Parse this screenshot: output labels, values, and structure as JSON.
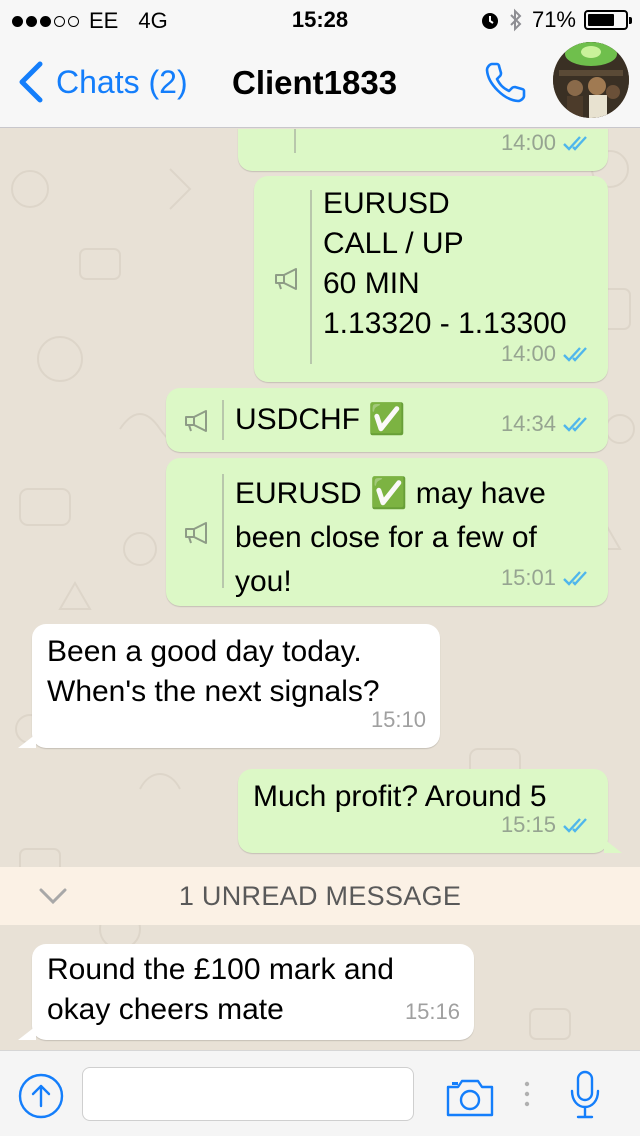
{
  "status_bar": {
    "carrier": "EE",
    "network": "4G",
    "time": "15:28",
    "battery": "71%",
    "battery_level": 0.71,
    "signal_filled": 3,
    "signal_total": 5
  },
  "nav": {
    "back_label": "Chats (2)",
    "title": "Client1833"
  },
  "messages": [
    {
      "dir": "out",
      "text": "",
      "time": "14:00",
      "forwarded": true,
      "status": "read"
    },
    {
      "dir": "out",
      "lines": [
        "EURUSD",
        "CALL / UP",
        "60 MIN",
        "1.13320 - 1.13300"
      ],
      "time": "14:00",
      "forwarded": true,
      "status": "read"
    },
    {
      "dir": "out",
      "text": "USDCHF ✅",
      "time": "14:34",
      "forwarded": true,
      "status": "read"
    },
    {
      "dir": "out",
      "lines": [
        "EURUSD ✅ may have",
        "been close for a few of",
        "you!"
      ],
      "time": "15:01",
      "forwarded": true,
      "status": "read"
    },
    {
      "dir": "in",
      "lines": [
        "Been a good day today.",
        "When's the next signals?"
      ],
      "time": "15:10"
    },
    {
      "dir": "out",
      "text": "Much profit? Around 5",
      "time": "15:15",
      "status": "read"
    },
    {
      "dir": "in",
      "lines": [
        "Round the £100 mark and",
        "okay cheers mate"
      ],
      "time": "15:16"
    }
  ],
  "unread": {
    "label": "1 UNREAD MESSAGE"
  },
  "input": {
    "value": "",
    "placeholder": ""
  },
  "icons": {
    "back": "chevron-left-icon",
    "call": "phone-icon",
    "forwarded": "megaphone-icon",
    "read": "double-check-icon",
    "unread_toggle": "chevron-down-icon",
    "upload": "arrow-up-circle-icon",
    "camera": "camera-icon",
    "mic": "microphone-icon"
  },
  "colors": {
    "accent": "#147efb",
    "outgoing_bubble": "#dcf8c6",
    "incoming_bubble": "#ffffff",
    "read_ticks": "#4fb6ec",
    "chat_background": "#e8e1d6"
  }
}
